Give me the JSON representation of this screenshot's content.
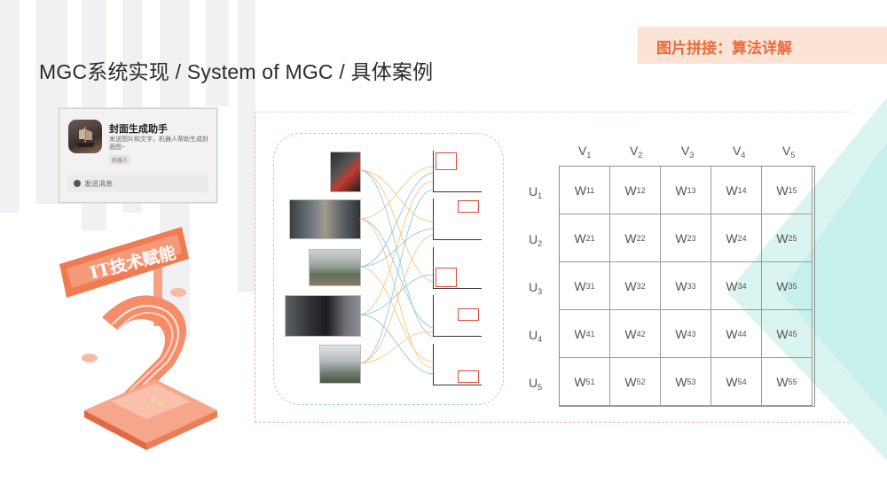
{
  "title": "MGC系统实现 / System of MGC / 具体案例",
  "tag": "图片拼接：算法详解",
  "app_card": {
    "name": "封面生成助手",
    "description": "发送图片和文字，机器人帮助生成封面图~",
    "chip": "机器人",
    "button_label": "发送消息"
  },
  "illustration": {
    "sign_text": "IT技术赋能",
    "number": "2"
  },
  "matrix": {
    "columns": [
      "V1",
      "V2",
      "V3",
      "V4",
      "V5"
    ],
    "rows": [
      "U1",
      "U2",
      "U3",
      "U4",
      "U5"
    ],
    "cells": [
      [
        "W11",
        "W12",
        "W13",
        "W14",
        "W15"
      ],
      [
        "W21",
        "W22",
        "W23",
        "W24",
        "W25"
      ],
      [
        "W31",
        "W32",
        "W33",
        "W34",
        "W35"
      ],
      [
        "W41",
        "W42",
        "W43",
        "W44",
        "W45"
      ],
      [
        "W51",
        "W52",
        "W53",
        "W54",
        "W55"
      ]
    ]
  },
  "colors": {
    "accent_orange": "#ec6b3b",
    "tag_bg": "#fbe3d6",
    "teal": "#c7f0ec"
  }
}
